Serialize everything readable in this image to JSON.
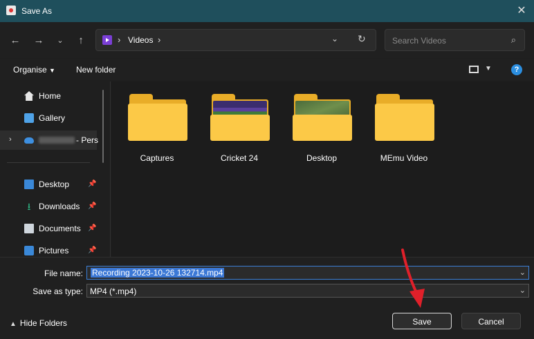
{
  "window": {
    "title": "Save As"
  },
  "address": {
    "crumb": "Videos"
  },
  "search": {
    "placeholder": "Search Videos"
  },
  "commands": {
    "organise": "Organise",
    "new_folder": "New folder"
  },
  "sidebar": {
    "items": [
      {
        "label": "Home"
      },
      {
        "label": "Gallery"
      },
      {
        "label": "- Pers"
      },
      {
        "label": "Desktop"
      },
      {
        "label": "Downloads"
      },
      {
        "label": "Documents"
      },
      {
        "label": "Pictures"
      }
    ]
  },
  "folders": [
    {
      "name": "Captures"
    },
    {
      "name": "Cricket 24"
    },
    {
      "name": "Desktop"
    },
    {
      "name": "MEmu Video"
    }
  ],
  "file_name": {
    "label": "File name:",
    "value": "Recording 2023-10-26 132714.mp4"
  },
  "save_as_type": {
    "label": "Save as type:",
    "value": "MP4 (*.mp4)"
  },
  "footer": {
    "hide_folders": "Hide Folders",
    "save": "Save",
    "cancel": "Cancel"
  },
  "colors": {
    "accent": "#3b78d6",
    "titlebar": "#1f4f5c",
    "folder": "#fcc947",
    "annotation_arrow": "#e0202a"
  }
}
